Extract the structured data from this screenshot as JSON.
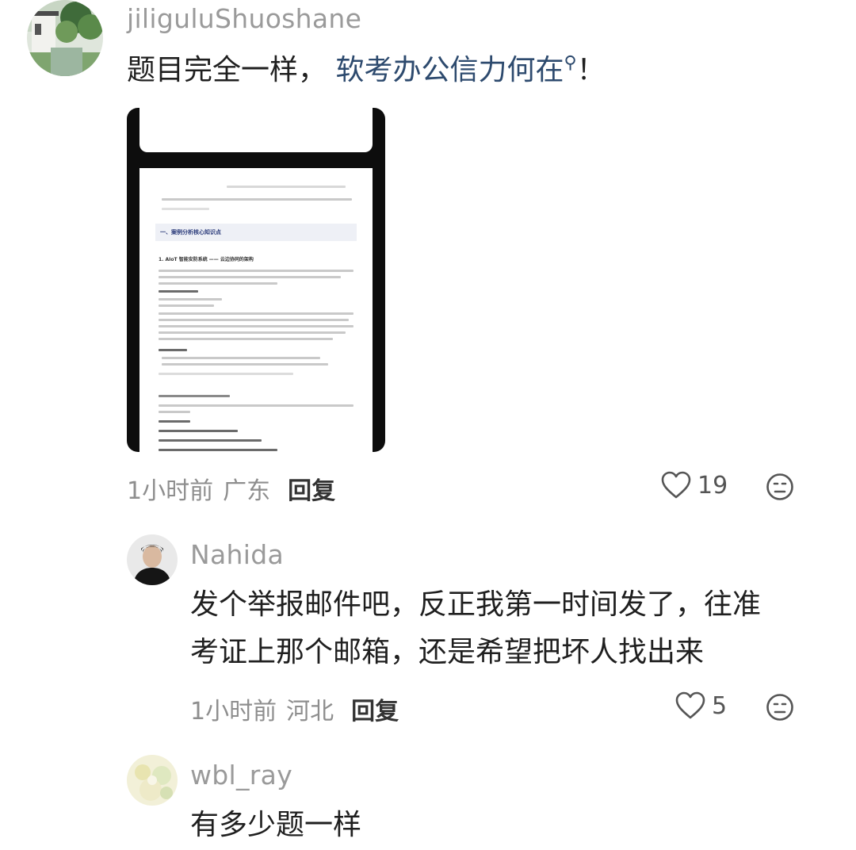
{
  "comments": [
    {
      "username": "jiliguluShuoshane",
      "text_plain": "题目完全一样，",
      "text_link": "软考办公信力何在",
      "search_icon": "search-icon",
      "text_tail": "！",
      "time": "1小时前",
      "location": "广东",
      "reply_label": "回复",
      "likes": "19",
      "attachment": {
        "doc_section_title": "一、案例分析核心知识点",
        "doc_subtitle": "1. AIoT 智能安防系统 —— 云边协同的架构"
      }
    },
    {
      "username": "Nahida",
      "text_line1": "发个举报邮件吧，反正我第一时间发了，往准",
      "text_line2": "考证上那个邮箱，还是希望把坏人找出来",
      "time": "1小时前",
      "location": "河北",
      "reply_label": "回复",
      "likes": "5"
    },
    {
      "username": "wbl_ray",
      "text_line1": "有多少题一样"
    }
  ],
  "colors": {
    "link": "#2d4a6e",
    "meta": "#8e8e8e",
    "username": "#9a9a9a"
  }
}
